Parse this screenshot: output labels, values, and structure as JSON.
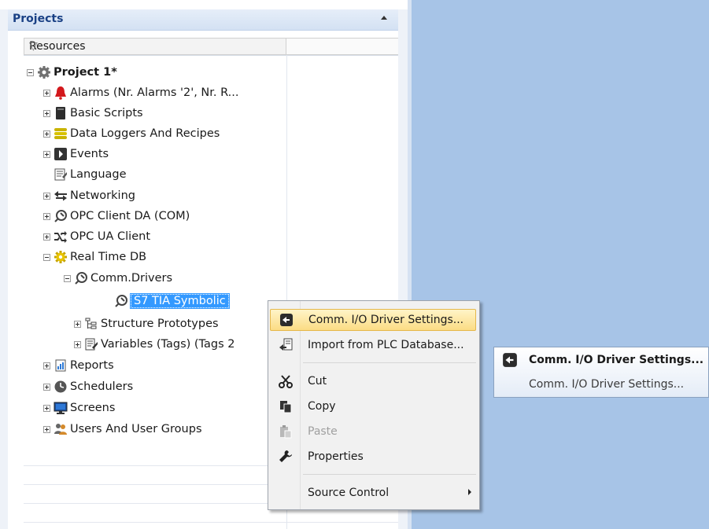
{
  "panel": {
    "title": "Projects"
  },
  "columns": {
    "resources": "Resources"
  },
  "tree": {
    "project": "Project 1*",
    "alarms": "Alarms (Nr. Alarms '2', Nr. R...",
    "basic_scripts": "Basic Scripts",
    "data_loggers": "Data Loggers And Recipes",
    "events": "Events",
    "language": "Language",
    "networking": "Networking",
    "opc_client": "OPC Client DA (COM)",
    "opc_ua": "OPC UA Client",
    "real_time_db": "Real Time DB",
    "comm_drivers": "Comm.Drivers",
    "s7_tia": "S7 TIA Symbolic",
    "structure_prototypes": "Structure Prototypes",
    "variables": "Variables (Tags) (Tags 2",
    "reports": "Reports",
    "schedulers": "Schedulers",
    "screens": "Screens",
    "users": "Users And User Groups"
  },
  "context_menu": {
    "driver_settings": "Comm. I/O Driver Settings...",
    "import_plc": "Import from PLC Database...",
    "cut": "Cut",
    "copy": "Copy",
    "paste": "Paste",
    "properties": "Properties",
    "source_control": "Source Control"
  },
  "tooltip": {
    "title": "Comm. I/O Driver Settings...",
    "body": "Comm. I/O Driver Settings..."
  },
  "colors": {
    "accent_blue": "#3399ff",
    "workspace": "#a7c4e7",
    "menu_highlight": "#fbdc84"
  }
}
